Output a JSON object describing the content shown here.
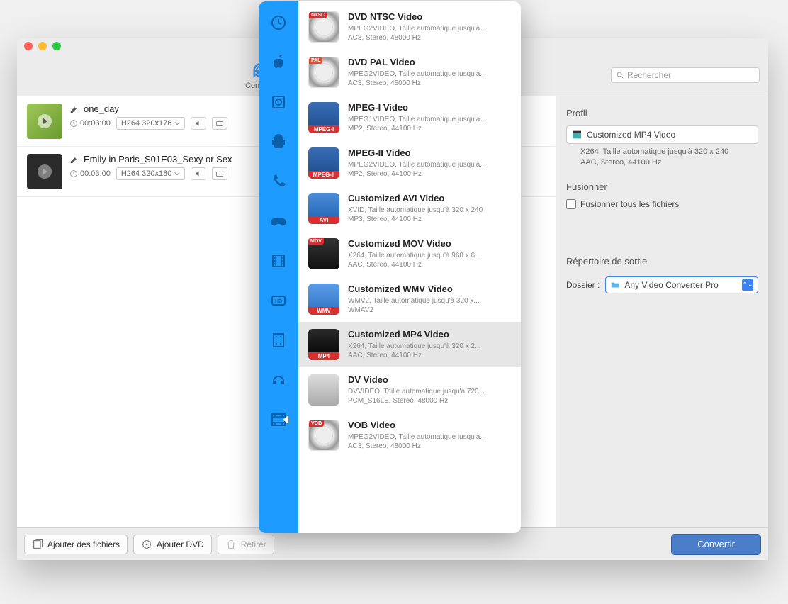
{
  "window": {
    "toolbar": {
      "convert_label": "Convertir"
    },
    "search_placeholder": "Rechercher"
  },
  "files": [
    {
      "title": "one_day",
      "duration": "00:03:00",
      "format": "H264 320x176"
    },
    {
      "title": "Emily in Paris_S01E03_Sexy or Sex",
      "duration": "00:03:00",
      "format": "H264 320x180"
    }
  ],
  "right": {
    "profile_label": "Profil",
    "profile_name": "Customized MP4 Video",
    "profile_desc_line1": "X264, Taille automatique jusqu'à 320 x 240",
    "profile_desc_line2": "AAC, Stereo, 44100 Hz",
    "merge_label": "Fusionner",
    "merge_all": "Fusionner tous les fichiers",
    "outdir_label": "Répertoire de sortie",
    "folder_label": "Dossier :",
    "folder_value": "Any Video Converter Pro"
  },
  "footer": {
    "add_files": "Ajouter des fichiers",
    "add_dvd": "Ajouter DVD",
    "remove": "Retirer",
    "convert": "Convertir"
  },
  "formats": [
    {
      "key": "ntsc",
      "title": "DVD NTSC Video",
      "line1": "MPEG2VIDEO, Taille automatique jusqu'à...",
      "line2": "AC3, Stereo, 48000 Hz",
      "icon": "ic-dvd",
      "badge": "NTSC",
      "badgeClass": "badge-ntsc"
    },
    {
      "key": "pal",
      "title": "DVD PAL Video",
      "line1": "MPEG2VIDEO, Taille automatique jusqu'à...",
      "line2": "AC3, Stereo, 48000 Hz",
      "icon": "ic-dvd",
      "badge": "PAL",
      "badgeClass": "badge-pal"
    },
    {
      "key": "mpeg1",
      "title": "MPEG-I Video",
      "line1": "MPEG1VIDEO, Taille automatique jusqu'à...",
      "line2": "MP2, Stereo, 44100 Hz",
      "icon": "ic-mpeg1",
      "strip": "MPEG-I"
    },
    {
      "key": "mpeg2",
      "title": "MPEG-II Video",
      "line1": "MPEG2VIDEO, Taille automatique jusqu'à...",
      "line2": "MP2, Stereo, 44100 Hz",
      "icon": "ic-mpeg2",
      "strip": "MPEG-II"
    },
    {
      "key": "avi",
      "title": "Customized AVI Video",
      "line1": "XVID, Taille automatique jusqu'à 320 x 240",
      "line2": "MP3, Stereo, 44100 Hz",
      "icon": "ic-avi",
      "strip": "AVI"
    },
    {
      "key": "mov",
      "title": "Customized MOV Video",
      "line1": "X264, Taille automatique jusqu'à 960 x 6...",
      "line2": "AAC, Stereo, 44100 Hz",
      "icon": "ic-mov",
      "badge": "MOV",
      "badgeClass": "badge-mov"
    },
    {
      "key": "wmv",
      "title": "Customized WMV Video",
      "line1": "WMV2, Taille automatique jusqu'à 320 x...",
      "line2": "WMAV2",
      "icon": "ic-wmv",
      "strip": "WMV"
    },
    {
      "key": "mp4",
      "title": "Customized MP4 Video",
      "line1": "X264, Taille automatique jusqu'à 320 x 2...",
      "line2": "AAC, Stereo, 44100 Hz",
      "icon": "ic-mp4",
      "strip": "MP4",
      "selected": true
    },
    {
      "key": "dv",
      "title": "DV Video",
      "line1": "DVVIDEO, Taille automatique jusqu'à 720...",
      "line2": "PCM_S16LE, Stereo, 48000 Hz",
      "icon": "ic-dv"
    },
    {
      "key": "vob",
      "title": "VOB Video",
      "line1": "MPEG2VIDEO, Taille automatique jusqu'à...",
      "line2": "AC3, Stereo, 48000 Hz",
      "icon": "ic-vob",
      "badge": "VOB",
      "badgeClass": "badge-vob"
    }
  ],
  "categories": [
    "clock",
    "apple",
    "disc",
    "android",
    "phone",
    "gamepad",
    "film",
    "hd",
    "filmstrip",
    "headphones",
    "video-active"
  ]
}
